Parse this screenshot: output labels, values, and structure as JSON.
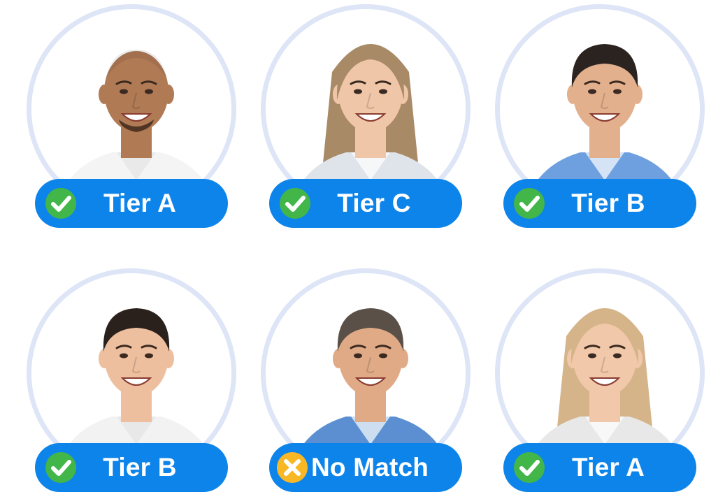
{
  "colors": {
    "ring": "#dde5f6",
    "badge": "#0d84ea",
    "badge_text": "#ffffff",
    "match_icon": "#43b649",
    "no_match_icon": "#f8b825"
  },
  "candidates": [
    {
      "label": "Tier A",
      "status": "match",
      "icon": "check-circle-icon",
      "hair": "bald",
      "hair_color": "#3a2418",
      "skin": "#b07a55",
      "shirt": "#f4f4f4"
    },
    {
      "label": "Tier C",
      "status": "match",
      "icon": "check-circle-icon",
      "hair": "long",
      "hair_color": "#a98a66",
      "skin": "#f0c6a8",
      "shirt": "#dfe4ea"
    },
    {
      "label": "Tier B",
      "status": "match",
      "icon": "check-circle-icon",
      "hair": "short",
      "hair_color": "#2b2320",
      "skin": "#e3b08e",
      "shirt": "#6ea0e0"
    },
    {
      "label": "Tier B",
      "status": "match",
      "icon": "check-circle-icon",
      "hair": "short",
      "hair_color": "#2a201c",
      "skin": "#edbf9f",
      "shirt": "#f2f2f2"
    },
    {
      "label": "No Match",
      "status": "no-match",
      "icon": "x-circle-icon",
      "hair": "short",
      "hair_color": "#5a5048",
      "skin": "#e0aa86",
      "shirt": "#5b8fd1"
    },
    {
      "label": "Tier A",
      "status": "match",
      "icon": "check-circle-icon",
      "hair": "long",
      "hair_color": "#d6b48a",
      "skin": "#f1c8aa",
      "shirt": "#e8e8e8"
    }
  ]
}
